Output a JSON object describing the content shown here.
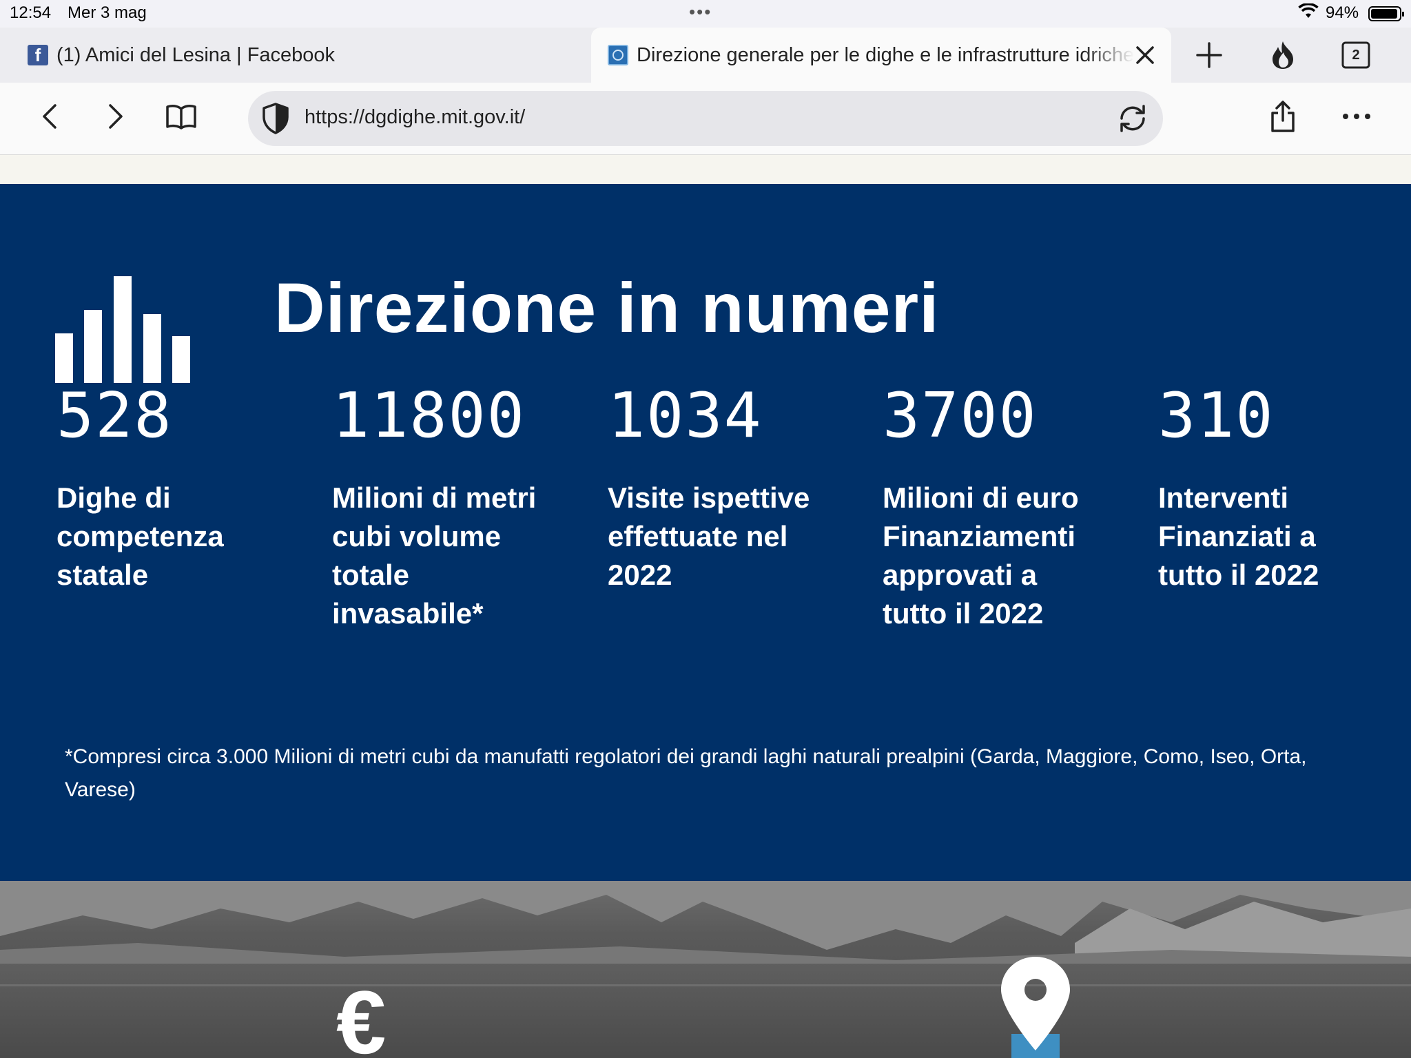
{
  "status_bar": {
    "time": "12:54",
    "date": "Mer 3 mag",
    "battery": "94%"
  },
  "tabs": [
    {
      "title": "(1) Amici del Lesina | Facebook",
      "favicon": "facebook-icon"
    },
    {
      "title": "Direzione generale per le dighe e le infrastrutture idriche",
      "favicon": "mit-emblem-icon",
      "active": true
    }
  ],
  "tab_count": "2",
  "address_bar": {
    "url": "https://dgdighe.mit.gov.it/"
  },
  "section": {
    "title": "Direzione in numeri",
    "background_color": "#003068",
    "stats": [
      {
        "value": "528",
        "label": "Dighe di competenza statale"
      },
      {
        "value": "11800",
        "label": "Milioni di metri cubi volume totale invasabile*"
      },
      {
        "value": "1034",
        "label": "Visite ispettive effettuate nel 2022"
      },
      {
        "value": "3700",
        "label": "Milioni di euro Finanziamenti approvati a tutto il 2022"
      },
      {
        "value": "310",
        "label": "Interventi Finanziati a tutto il 2022"
      }
    ],
    "footnote": "*Compresi circa 3.000 Milioni di metri cubi da manufatti regolatori dei grandi laghi naturali prealpini (Garda, Maggiore, Como, Iseo, Orta, Varese)"
  },
  "lower_section": {
    "icons": [
      "euro-icon",
      "location-pin-icon"
    ]
  }
}
